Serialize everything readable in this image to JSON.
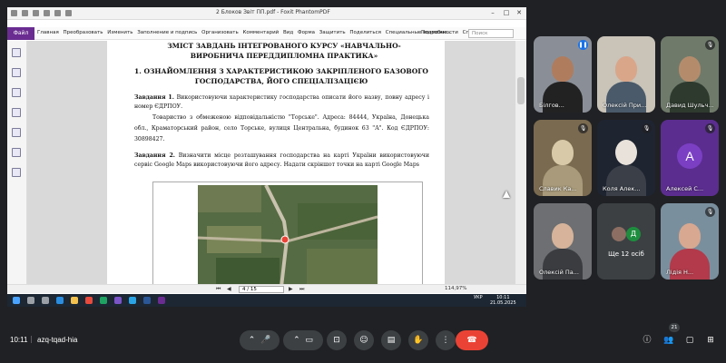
{
  "viewer": {
    "window_title": "2 Блоков Звіт ПП.pdf - Foxit PhantomPDF",
    "menu_file": "Файл",
    "menu": [
      "Главная",
      "Преобразовать",
      "Изменить",
      "Заполнение и подпись",
      "Организовать",
      "Комментарий",
      "Вид",
      "Форма",
      "Защитить",
      "Поделиться",
      "Специальные возможности",
      "Справка"
    ],
    "help_link": "Подробне...",
    "search_placeholder": "Поиск",
    "page_indicator": "4 / 15",
    "zoom": "114,97%"
  },
  "document": {
    "title": "ЗМІСТ ЗАВДАНЬ ІНТЕГРОВАНОГО КУРСУ «НАВЧАЛЬНО-ВИРОБНИЧА ПЕРЕДДИПЛОМНА ПРАКТИКА»",
    "section": "1. ОЗНАЙОМЛЕННЯ З ХАРАКТЕРИСТИКОЮ ЗАКРІПЛЕНОГО БАЗОВОГО ГОСПОДАРСТВА, ЙОГО СПЕЦІАЛІЗАЦІЄЮ",
    "task1_label": "Завдання 1.",
    "task1_text": "Використовуючи характеристику господарства описати його назву, повну адресу і номер ЄДРПОУ.",
    "company_text": "Товариство з обмеженою відповідальністю \"Торське\". Адреса: 84444, Україна, Донецька обл., Краматорський район, село Торське, вулиця Центральна, будинок 63 \"А\". Код ЄДРПОУ: 30898427.",
    "task2_label": "Завдання 2.",
    "task2_text": "Визначити місце розташування господарства на карті України використовуючи сервіс Google Maps використовуючи його адресу. Надати скріншот точки на карті Google Maps"
  },
  "taskbar": {
    "lang": "УКР",
    "time": "10:11",
    "date": "21.05.2025"
  },
  "participants": [
    {
      "name": "Білгов...",
      "mic": "speaking"
    },
    {
      "name": "Олексій При...",
      "mic": "on"
    },
    {
      "name": "Давид Шульч...",
      "mic": "muted"
    },
    {
      "name": "Славик Ка...",
      "mic": "muted"
    },
    {
      "name": "Коля Алек...",
      "mic": "muted"
    },
    {
      "name": "Алексей С...",
      "mic": "muted",
      "avatar_letter": "A"
    },
    {
      "name": "Олексій Па...",
      "mic": "on"
    },
    {
      "name": "Ще 12 осіб",
      "mic": "none",
      "mini_letter": "Д"
    },
    {
      "name": "Лідія Н...",
      "mic": "muted"
    }
  ],
  "meeting": {
    "time": "10:11",
    "separator": "|",
    "code": "azq-tqad-hia",
    "people_count": "21"
  },
  "colors": {
    "background": "#202124",
    "control": "#3c4043",
    "hangup": "#ea4335",
    "foxit_accent": "#6a2c91",
    "avatar_purple": "#7b3fc4"
  }
}
